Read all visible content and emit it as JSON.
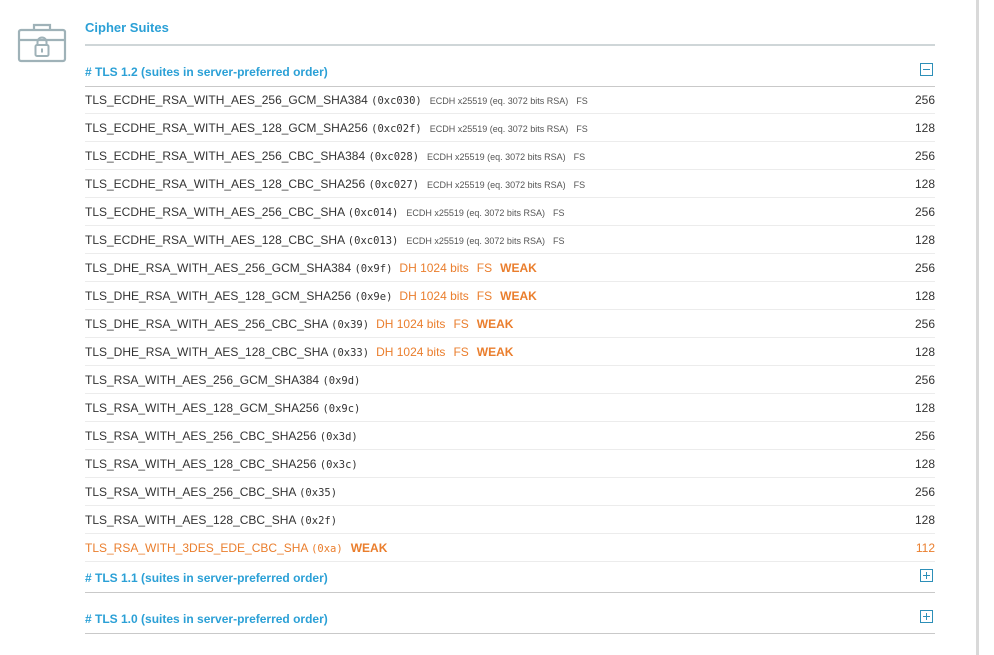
{
  "section": {
    "title": "Cipher Suites"
  },
  "groups": [
    {
      "label": "# TLS 1.2 (suites in server-preferred order)",
      "state": "expanded",
      "toggle_icon": "minus-box-icon"
    },
    {
      "label": "# TLS 1.1 (suites in server-preferred order)",
      "state": "collapsed",
      "toggle_icon": "plus-box-icon"
    },
    {
      "label": "# TLS 1.0 (suites in server-preferred order)",
      "state": "collapsed",
      "toggle_icon": "plus-box-icon"
    }
  ],
  "suites": [
    {
      "name": "TLS_ECDHE_RSA_WITH_AES_256_GCM_SHA384",
      "code": "(0xc030)",
      "kex": "ECDH x25519 (eq. 3072 bits RSA)",
      "fs": "FS",
      "weak": "",
      "bits": "256"
    },
    {
      "name": "TLS_ECDHE_RSA_WITH_AES_128_GCM_SHA256",
      "code": "(0xc02f)",
      "kex": "ECDH x25519 (eq. 3072 bits RSA)",
      "fs": "FS",
      "weak": "",
      "bits": "128"
    },
    {
      "name": "TLS_ECDHE_RSA_WITH_AES_256_CBC_SHA384",
      "code": "(0xc028)",
      "kex": "ECDH x25519 (eq. 3072 bits RSA)",
      "fs": "FS",
      "weak": "",
      "bits": "256"
    },
    {
      "name": "TLS_ECDHE_RSA_WITH_AES_128_CBC_SHA256",
      "code": "(0xc027)",
      "kex": "ECDH x25519 (eq. 3072 bits RSA)",
      "fs": "FS",
      "weak": "",
      "bits": "128"
    },
    {
      "name": "TLS_ECDHE_RSA_WITH_AES_256_CBC_SHA",
      "code": "(0xc014)",
      "kex": "ECDH x25519 (eq. 3072 bits RSA)",
      "fs": "FS",
      "weak": "",
      "bits": "256"
    },
    {
      "name": "TLS_ECDHE_RSA_WITH_AES_128_CBC_SHA",
      "code": "(0xc013)",
      "kex": "ECDH x25519 (eq. 3072 bits RSA)",
      "fs": "FS",
      "weak": "",
      "bits": "128"
    },
    {
      "name": "TLS_DHE_RSA_WITH_AES_256_GCM_SHA384",
      "code": "(0x9f)",
      "kex": "DH 1024 bits",
      "fs": "FS",
      "weak": "WEAK",
      "bits": "256"
    },
    {
      "name": "TLS_DHE_RSA_WITH_AES_128_GCM_SHA256",
      "code": "(0x9e)",
      "kex": "DH 1024 bits",
      "fs": "FS",
      "weak": "WEAK",
      "bits": "128"
    },
    {
      "name": "TLS_DHE_RSA_WITH_AES_256_CBC_SHA",
      "code": "(0x39)",
      "kex": "DH 1024 bits",
      "fs": "FS",
      "weak": "WEAK",
      "bits": "256"
    },
    {
      "name": "TLS_DHE_RSA_WITH_AES_128_CBC_SHA",
      "code": "(0x33)",
      "kex": "DH 1024 bits",
      "fs": "FS",
      "weak": "WEAK",
      "bits": "128"
    },
    {
      "name": "TLS_RSA_WITH_AES_256_GCM_SHA384",
      "code": "(0x9d)",
      "kex": "",
      "fs": "",
      "weak": "",
      "bits": "256"
    },
    {
      "name": "TLS_RSA_WITH_AES_128_GCM_SHA256",
      "code": "(0x9c)",
      "kex": "",
      "fs": "",
      "weak": "",
      "bits": "128"
    },
    {
      "name": "TLS_RSA_WITH_AES_256_CBC_SHA256",
      "code": "(0x3d)",
      "kex": "",
      "fs": "",
      "weak": "",
      "bits": "256"
    },
    {
      "name": "TLS_RSA_WITH_AES_128_CBC_SHA256",
      "code": "(0x3c)",
      "kex": "",
      "fs": "",
      "weak": "",
      "bits": "128"
    },
    {
      "name": "TLS_RSA_WITH_AES_256_CBC_SHA",
      "code": "(0x35)",
      "kex": "",
      "fs": "",
      "weak": "",
      "bits": "256"
    },
    {
      "name": "TLS_RSA_WITH_AES_128_CBC_SHA",
      "code": "(0x2f)",
      "kex": "",
      "fs": "",
      "weak": "",
      "bits": "128"
    },
    {
      "name": "TLS_RSA_WITH_3DES_EDE_CBC_SHA",
      "code": "(0xa)",
      "kex": "",
      "fs": "",
      "weak": "WEAK",
      "bits": "112",
      "whole_row_weak": true
    }
  ],
  "colors": {
    "accent": "#2ba0d6",
    "warning": "#ea7e2d",
    "text": "#333333",
    "icon": "#9fb2b8"
  }
}
